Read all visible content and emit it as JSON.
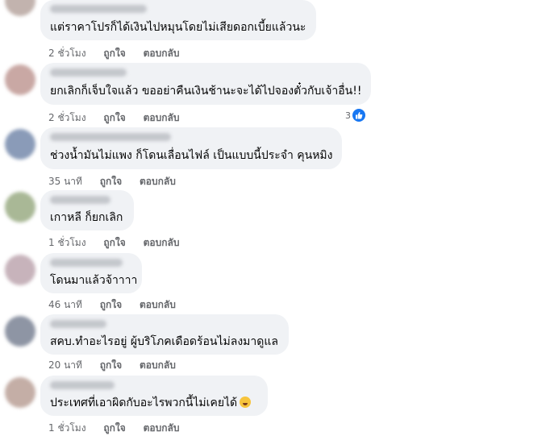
{
  "comments": [
    {
      "text": "แต่ราคาโปรก็ได้เงินไปหมุนโดยไม่เสียดอกเบี้ยแล้วนะ",
      "time": "2 ชั่วโมง",
      "like": "ถูกใจ",
      "reply": "ตอบกลับ",
      "avatar_color": "#c2b3ae"
    },
    {
      "text": "ยกเลิกก็เจ็บใจแล้ว ขออย่าคืนเงินช้านะจะได้ไปจองตั๋วกับเจ้าอื่น!!",
      "time": "2 ชั่วโมง",
      "like": "ถูกใจ",
      "reply": "ตอบกลับ",
      "reaction_count": "3",
      "avatar_color": "#c9a8a4"
    },
    {
      "text": "ช่วงน้ำมันไม่แพง ก็โดนเลื่อนไฟล์ เป็นแบบนี้ประจำ คุนหมิง",
      "time": "35 นาที",
      "like": "ถูกใจ",
      "reply": "ตอบกลับ",
      "avatar_color": "#8a9bb8"
    },
    {
      "text": "เกาหลี ก็ยกเลิก",
      "time": "1 ชั่วโมง",
      "like": "ถูกใจ",
      "reply": "ตอบกลับ",
      "avatar_color": "#a9b896"
    },
    {
      "text": "โดนมาแล้วจ้าาาา",
      "time": "46 นาที",
      "like": "ถูกใจ",
      "reply": "ตอบกลับ",
      "avatar_color": "#c7b3bb"
    },
    {
      "text": "สคบ.ทำอะไรอยู่ ผู้บริโภคเดือดร้อนไม่ลงมาดูแล",
      "time": "20 นาที",
      "like": "ถูกใจ",
      "reply": "ตอบกลับ",
      "avatar_color": "#8e95a4"
    },
    {
      "text": "ประเทศที่เอาผิดกับอะไรพวกนี้ไม่เคยได้",
      "time": "1 ชั่วโมง",
      "like": "ถูกใจ",
      "reply": "ตอบกลับ",
      "emoji": "persevering-face-icon",
      "avatar_color": "#c4aea6"
    }
  ]
}
